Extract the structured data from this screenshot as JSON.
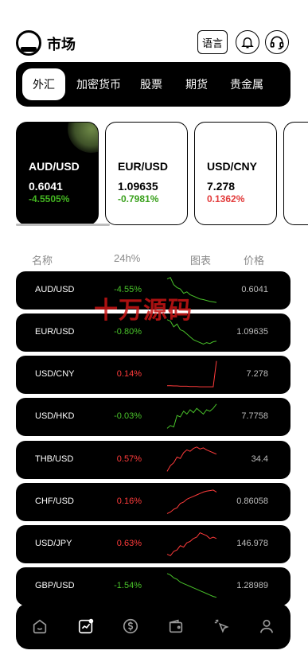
{
  "header": {
    "title": "市场",
    "language_label": "语言",
    "icons": [
      "logo-icon",
      "bell-icon",
      "headset-icon"
    ]
  },
  "tabs": [
    {
      "label": "外汇",
      "active": true
    },
    {
      "label": "加密货币",
      "active": false
    },
    {
      "label": "股票",
      "active": false
    },
    {
      "label": "期货",
      "active": false
    },
    {
      "label": "贵金属",
      "active": false
    }
  ],
  "cards": [
    {
      "symbol": "AUD/USD",
      "price": "0.6041",
      "change": "-4.5505%",
      "direction": "down-green"
    },
    {
      "symbol": "EUR/USD",
      "price": "1.09635",
      "change": "-0.7981%",
      "direction": "down-green"
    },
    {
      "symbol": "USD/CNY",
      "price": "7.278",
      "change": "0.1362%",
      "direction": "up-red"
    }
  ],
  "columns": {
    "name": "名称",
    "change": "24h%",
    "chart": "图表",
    "price": "价格"
  },
  "rows": [
    {
      "symbol": "AUD/USD",
      "change": "-4.55%",
      "color": "green",
      "price": "0.6041",
      "spark": [
        90,
        95,
        70,
        60,
        55,
        40,
        45,
        35,
        30,
        25,
        20,
        18,
        15,
        12,
        10,
        8
      ]
    },
    {
      "symbol": "EUR/USD",
      "change": "-0.80%",
      "color": "green",
      "price": "1.09635",
      "spark": [
        95,
        90,
        70,
        80,
        60,
        55,
        45,
        35,
        25,
        20,
        15,
        10,
        15,
        12,
        18,
        20
      ]
    },
    {
      "symbol": "USD/CNY",
      "change": "0.14%",
      "color": "red",
      "price": "7.278",
      "spark": [
        12,
        12,
        11,
        11,
        10,
        10,
        10,
        9,
        9,
        9,
        8,
        8,
        8,
        8,
        8,
        98
      ]
    },
    {
      "symbol": "USD/HKD",
      "change": "-0.03%",
      "color": "green",
      "price": "7.7758",
      "spark": [
        10,
        20,
        15,
        55,
        50,
        70,
        60,
        75,
        65,
        80,
        70,
        60,
        75,
        70,
        80,
        95
      ]
    },
    {
      "symbol": "THB/USD",
      "change": "0.57%",
      "color": "red",
      "price": "34.4",
      "spark": [
        10,
        30,
        40,
        60,
        55,
        75,
        85,
        80,
        90,
        95,
        88,
        92,
        85,
        80,
        75,
        70
      ]
    },
    {
      "symbol": "CHF/USD",
      "change": "0.16%",
      "color": "red",
      "price": "0.86058",
      "spark": [
        10,
        15,
        25,
        30,
        45,
        50,
        60,
        65,
        70,
        75,
        80,
        85,
        88,
        90,
        92,
        85
      ]
    },
    {
      "symbol": "USD/JPY",
      "change": "0.63%",
      "color": "red",
      "price": "146.978",
      "spark": [
        15,
        10,
        25,
        30,
        45,
        40,
        55,
        60,
        70,
        75,
        90,
        85,
        80,
        70,
        75,
        70
      ]
    },
    {
      "symbol": "GBP/USD",
      "change": "-1.54%",
      "color": "green",
      "price": "1.28989",
      "spark": [
        95,
        90,
        80,
        75,
        65,
        60,
        55,
        50,
        45,
        40,
        35,
        30,
        25,
        20,
        15,
        12
      ]
    }
  ],
  "watermark": "十万源码",
  "bottom_nav": [
    {
      "icon": "home-icon",
      "active": false
    },
    {
      "icon": "market-chart-icon",
      "active": true
    },
    {
      "icon": "trade-coin-icon",
      "active": false
    },
    {
      "icon": "wallet-icon",
      "active": false
    },
    {
      "icon": "cursor-click-icon",
      "active": false
    },
    {
      "icon": "profile-icon",
      "active": false
    }
  ],
  "colors": {
    "up": "#ff3b3b",
    "down": "#49c22a",
    "background": "#000000"
  }
}
